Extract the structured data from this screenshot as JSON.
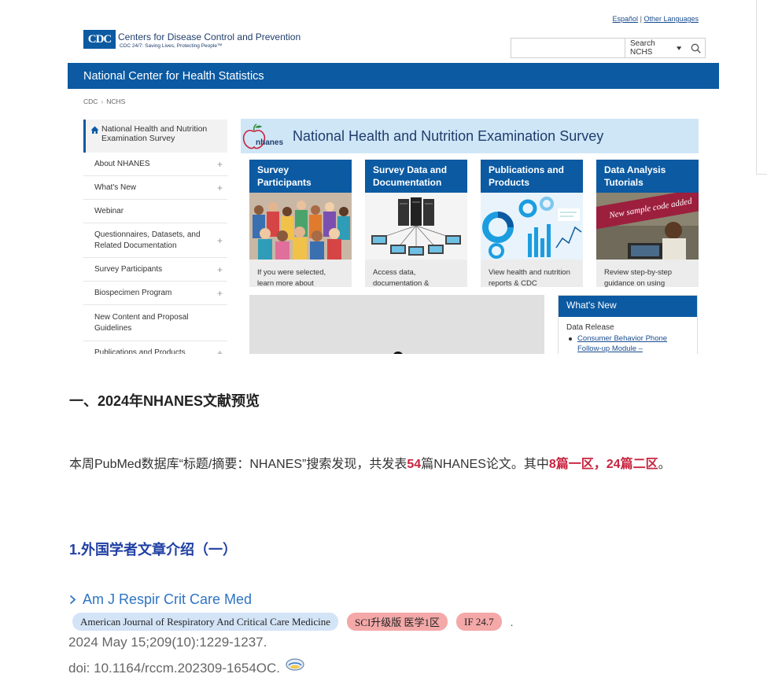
{
  "cdc_page": {
    "lang_links": [
      "Español",
      "Other Languages"
    ],
    "lang_sep": "|",
    "logo_mark": "CDC",
    "logo_title": "Centers for Disease Control and Prevention",
    "logo_subtitle": "CDC 24/7: Saving Lives, Protecting People™",
    "search_value": "",
    "search_label": "Search NCHS",
    "banner_title": "National Center for Health Statistics",
    "breadcrumb": [
      "CDC",
      "NCHS"
    ],
    "sidenav": {
      "home_label": "National Health and Nutrition Examination Survey",
      "items": [
        {
          "label": "About NHANES",
          "expandable": "+"
        },
        {
          "label": "What's New",
          "expandable": "+"
        },
        {
          "label": "Webinar",
          "expandable": ""
        },
        {
          "label": "Questionnaires, Datasets, and Related Documentation",
          "expandable": "+"
        },
        {
          "label": "Survey Participants",
          "expandable": "+"
        },
        {
          "label": "Biospecimen Program",
          "expandable": "+"
        },
        {
          "label": "New Content and Proposal Guidelines",
          "expandable": ""
        },
        {
          "label": "Publications and Products",
          "expandable": "+"
        }
      ]
    },
    "hero_logo_text": "nhanes",
    "hero_title": "National Health and Nutrition Examination Survey",
    "cards": [
      {
        "title": "Survey Participants",
        "text": "If you were selected, learn more about"
      },
      {
        "title": "Survey Data and Documentation",
        "text": "Access data, documentation &"
      },
      {
        "title": "Publications and Products",
        "text": "View health and nutrition reports & CDC"
      },
      {
        "title": "Data Analysis Tutorials",
        "text": "Review step-by-step guidance on using",
        "ribbon": "New sample code added"
      }
    ],
    "whats_new": {
      "title": "What's New",
      "subtitle": "Data Release",
      "link": "Consumer Behavior Phone Follow-up Module –"
    }
  },
  "article": {
    "section_title": "一、2024年NHANES文献预览",
    "para_parts": [
      "本周PubMed数据库“标题/摘要：NHANES”搜索发现，共发表",
      "54",
      "篇NHANES论文。其中",
      "8篇一区，24篇二区",
      "。"
    ],
    "sub_title": "1.外国学者文章介绍（一）",
    "journal_abbr": "Am J Respir Crit Care Med",
    "journal_full": "American Journal of Respiratory And Critical Care Medicine",
    "tag_sci": "SCI升级版 医学1区",
    "tag_if": "IF 24.7",
    "tag_dot": ".",
    "citation": "2024 May 15;209(10):1229-1237.",
    "doi": "doi: 10.1164/rccm.202309-1654OC."
  },
  "colors": {
    "cdc_blue": "#0b5aa2",
    "highlight_red": "#c8233f",
    "subtitle_blue": "#1f3fa3",
    "journal_blue": "#2e74c4"
  }
}
